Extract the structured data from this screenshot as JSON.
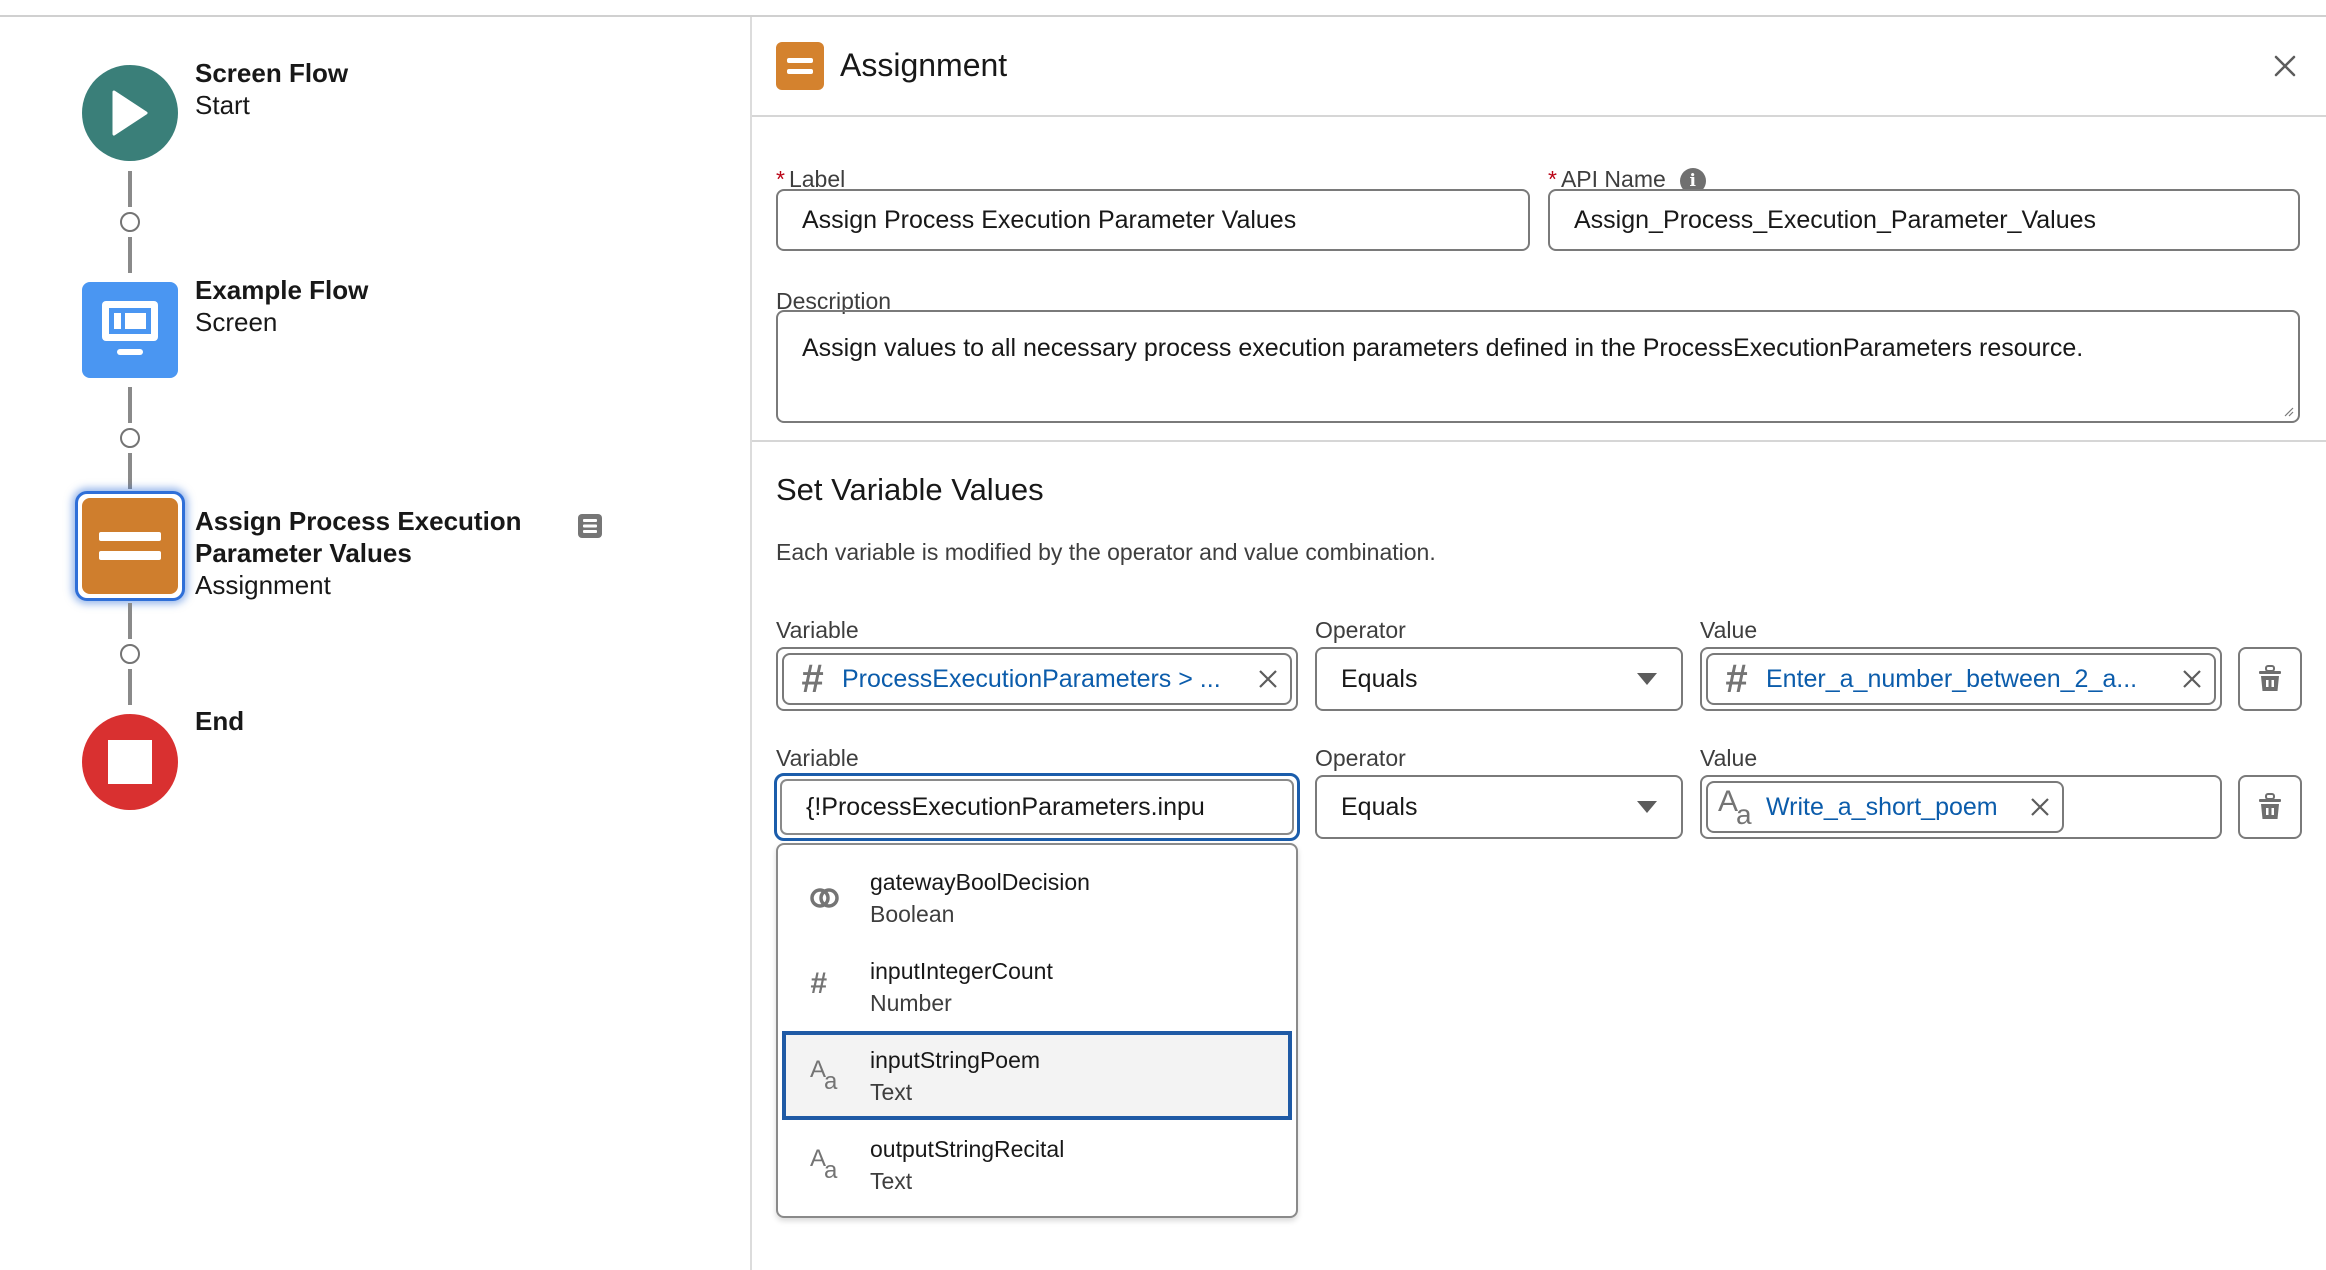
{
  "canvas": {
    "nodes": [
      {
        "title": "Screen Flow",
        "subtitle": "Start",
        "type": "start"
      },
      {
        "title": "Example Flow",
        "subtitle": "Screen",
        "type": "screen"
      },
      {
        "title_line1": "Assign Process Execution",
        "title_line2": "Parameter Values",
        "subtitle": "Assignment",
        "type": "assignment",
        "selected": true
      },
      {
        "title": "End",
        "type": "end"
      }
    ],
    "colors": {
      "start": "#3a7f79",
      "screen": "#4a96f2",
      "assignment": "#cf7e2d",
      "end": "#d93030"
    }
  },
  "panel": {
    "title": "Assignment",
    "label": {
      "required_mark": "*",
      "text": "Label",
      "value": "Assign Process Execution Parameter Values"
    },
    "api_name": {
      "required_mark": "*",
      "text": "API Name",
      "value": "Assign_Process_Execution_Parameter_Values"
    },
    "description": {
      "text": "Description",
      "value": "Assign values to all necessary process execution parameters defined in the ProcessExecutionParameters resource."
    },
    "section_title": "Set Variable Values",
    "section_help": "Each variable is modified by the operator and value combination.",
    "rows": [
      {
        "variable_label": "Variable",
        "variable_value": "ProcessExecutionParameters > ...",
        "variable_type_icon": "number-icon",
        "operator_label": "Operator",
        "operator_value": "Equals",
        "value_label": "Value",
        "value_value": "Enter_a_number_between_2_a...",
        "value_type_icon": "number-icon"
      },
      {
        "variable_label": "Variable",
        "variable_input": "{!ProcessExecutionParameters.inpu",
        "operator_label": "Operator",
        "operator_value": "Equals",
        "value_label": "Value",
        "value_value": "Write_a_short_poem",
        "value_type_icon": "text-icon"
      }
    ],
    "dropdown": [
      {
        "name": "gatewayBoolDecision",
        "type": "Boolean",
        "icon": "boolean-icon"
      },
      {
        "name": "inputIntegerCount",
        "type": "Number",
        "icon": "number-icon"
      },
      {
        "name": "inputStringPoem",
        "type": "Text",
        "icon": "text-icon",
        "highlighted": true
      },
      {
        "name": "outputStringRecital",
        "type": "Text",
        "icon": "text-icon"
      }
    ],
    "info_glyph": "i"
  }
}
